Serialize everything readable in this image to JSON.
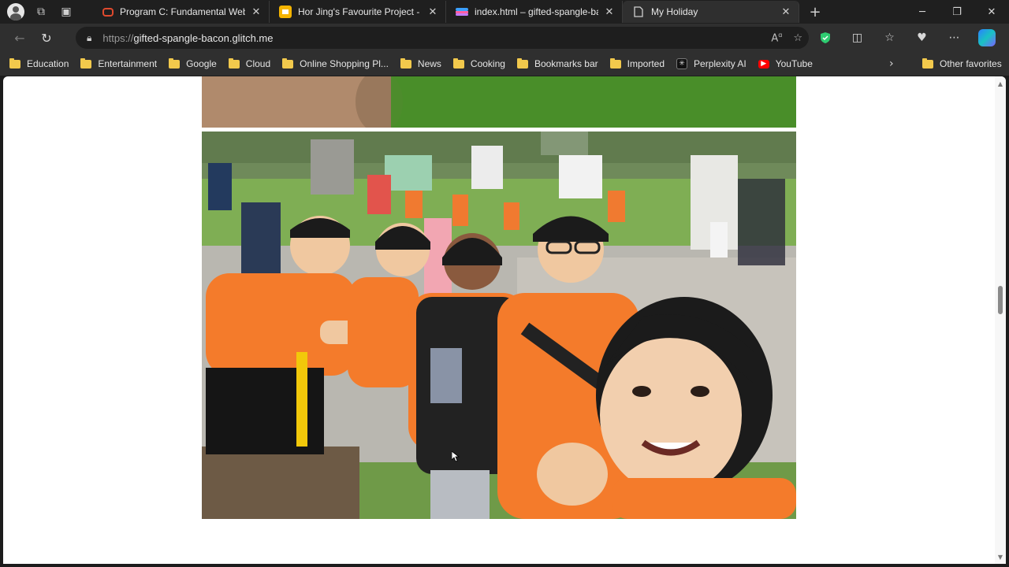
{
  "browser": {
    "tabs": [
      {
        "title": "Program C: Fundamental Web De",
        "favicon": "coursera-icon",
        "color": "#e04a2e",
        "active": false
      },
      {
        "title": "Hor Jing's Favourite Project - Go",
        "favicon": "google-slides-icon",
        "color": "#f4b400",
        "active": false
      },
      {
        "title": "index.html – gifted-spangle-bac",
        "favicon": "glitch-icon",
        "color": "#c37bff",
        "active": false
      },
      {
        "title": "My Holiday",
        "favicon": "page-icon",
        "color": "#cfcfcf",
        "active": true
      }
    ],
    "address": {
      "scheme": "https://",
      "host": "gifted-spangle-bacon.glitch.me"
    },
    "bookmarks": [
      {
        "label": "Education",
        "type": "folder"
      },
      {
        "label": "Entertainment",
        "type": "folder"
      },
      {
        "label": "Google",
        "type": "folder"
      },
      {
        "label": "Cloud",
        "type": "folder"
      },
      {
        "label": "Online Shopping Pl...",
        "type": "folder"
      },
      {
        "label": "News",
        "type": "folder"
      },
      {
        "label": "Cooking",
        "type": "folder"
      },
      {
        "label": "Bookmarks bar",
        "type": "folder"
      },
      {
        "label": "Imported",
        "type": "folder"
      },
      {
        "label": "Perplexity AI",
        "type": "site"
      },
      {
        "label": "YouTube",
        "type": "site"
      }
    ],
    "other_favorites": "Other favorites"
  },
  "page": {
    "photos": [
      {
        "name": "holiday-photo-partial-top"
      },
      {
        "name": "group-selfie-orange-shirts"
      }
    ],
    "scroll_position_fraction": 0.45
  }
}
